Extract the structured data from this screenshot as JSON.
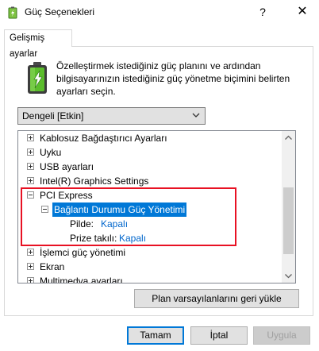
{
  "window": {
    "title": "Güç Seçenekleri",
    "help_label": "?",
    "close_label": "✕"
  },
  "tab": {
    "label": "Gelişmiş ayarlar"
  },
  "description": "Özelleştirmek istediğiniz güç planını ve ardından bilgisayarınızın istediğiniz güç yönetme biçimini belirten ayarları seçin.",
  "plan_select": {
    "value": "Dengeli [Etkin]"
  },
  "tree": {
    "wireless": "Kablosuz Bağdaştırıcı Ayarları",
    "sleep": "Uyku",
    "usb": "USB ayarları",
    "intel": "Intel(R) Graphics Settings",
    "pci": "PCI Express",
    "link_state": "Bağlantı Durumu Güç Yönetimi",
    "on_battery_label": "Pilde:",
    "on_battery_value": "Kapalı",
    "plugged_in_label": "Prize takılı:",
    "plugged_in_value": "Kapalı",
    "processor": "İşlemci güç yönetimi",
    "display": "Ekran",
    "multimedia": "Multimedya ayarları"
  },
  "restore_button": "Plan varsayılanlarını geri yükle",
  "buttons": {
    "ok": "Tamam",
    "cancel": "İptal",
    "apply": "Uygula"
  },
  "colors": {
    "selection": "#0078d7",
    "highlight_box": "#e81123",
    "link": "#0066cc"
  }
}
